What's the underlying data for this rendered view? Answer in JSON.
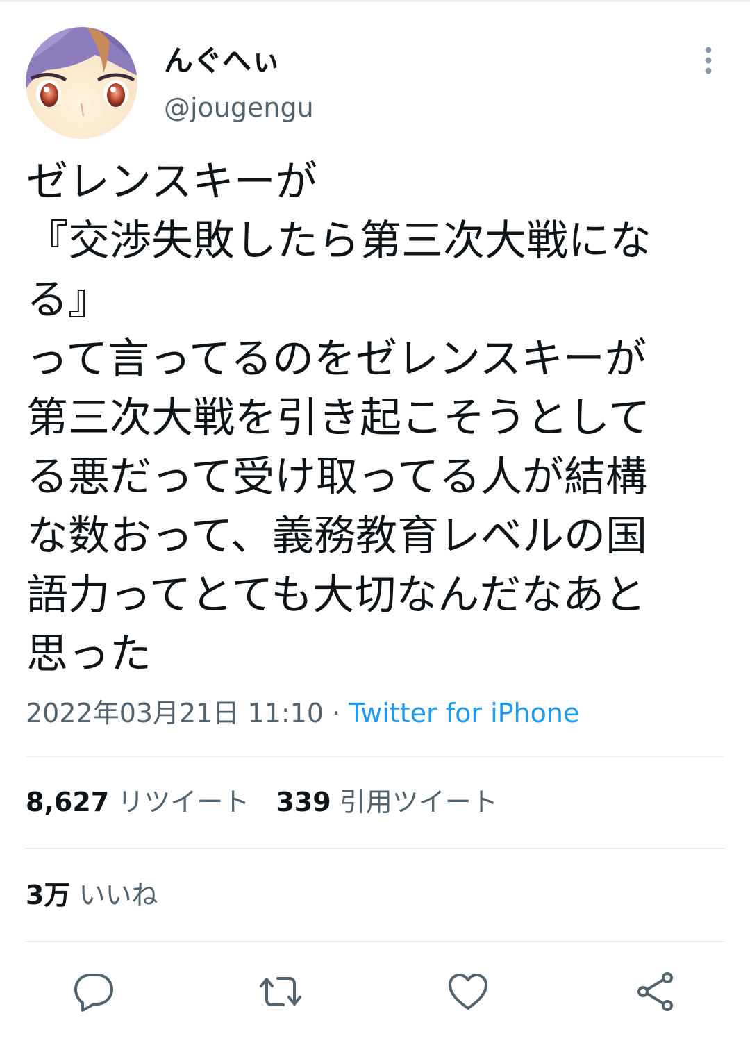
{
  "user": {
    "display_name": "んぐへぃ",
    "handle": "@jougengu"
  },
  "tweet": {
    "lines": [
      "ゼレンスキーが",
      "『交渉失敗したら第三次大戦にな",
      "る』",
      "って言ってるのをゼレンスキーが",
      "第三次大戦を引き起こそうとして",
      "る悪だって受け取ってる人が結構",
      "な数おって、義務教育レベルの国",
      "語力ってとても大切なんだなあと",
      "思った"
    ],
    "timestamp": "2022年03月21日 11:10",
    "separator": "·",
    "source": "Twitter for iPhone"
  },
  "stats": {
    "retweet_count": "8,627",
    "retweet_label": "リツイート",
    "quote_count": "339",
    "quote_label": "引用ツイート",
    "like_count": "3万",
    "like_label": "いいね"
  },
  "icons": {
    "more": "more-vertical-icon",
    "reply": "reply-icon",
    "retweet": "retweet-icon",
    "like": "heart-icon",
    "share": "share-icon"
  },
  "colors": {
    "text": "#0f1419",
    "secondary": "#536471",
    "link": "#1d9bf0",
    "divider": "#eceff1"
  }
}
